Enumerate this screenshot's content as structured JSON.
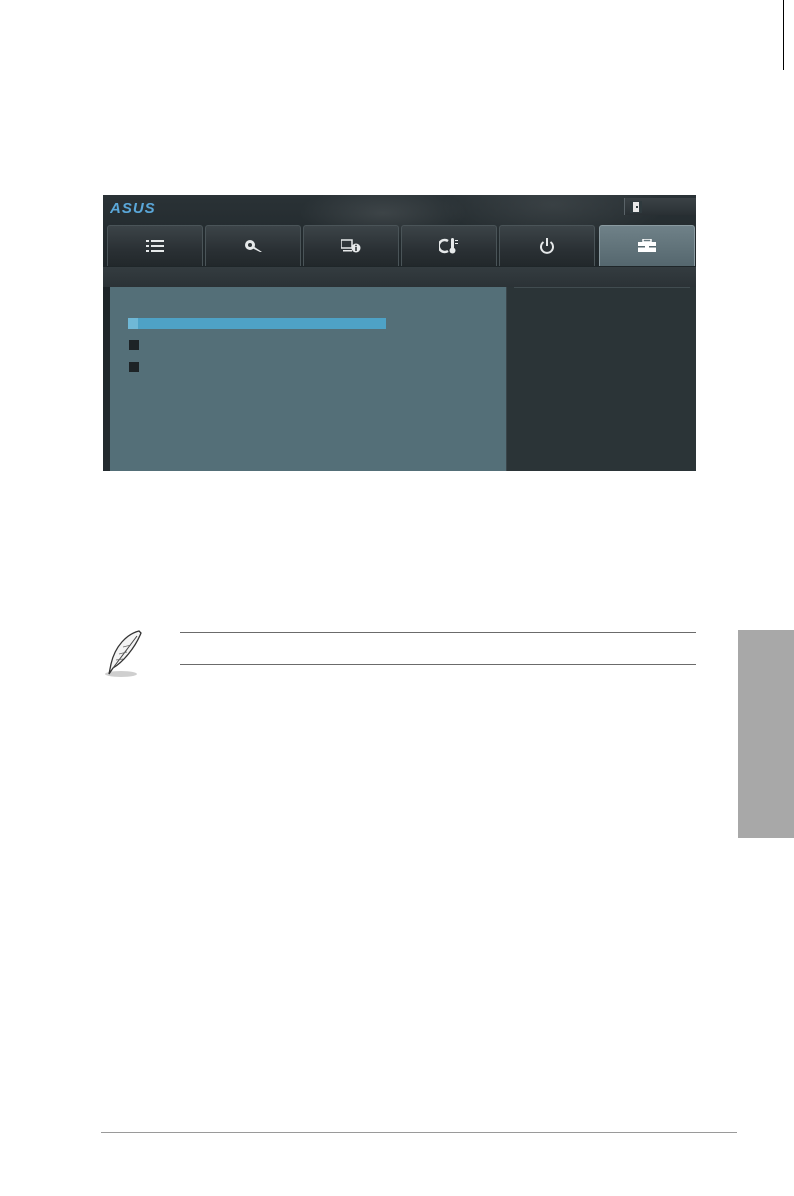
{
  "bios": {
    "logo_text": "ASUS",
    "exit_icon": "exit-door-icon",
    "tabs": [
      {
        "icon": "list-icon",
        "active": false
      },
      {
        "icon": "tweaker-icon",
        "active": false
      },
      {
        "icon": "advanced-info-icon",
        "active": false
      },
      {
        "icon": "monitor-thermometer-icon",
        "active": false
      },
      {
        "icon": "power-icon",
        "active": false
      },
      {
        "icon": "toolbox-icon",
        "active": true
      }
    ],
    "menu_items": [
      {
        "state": "selected"
      },
      {
        "state": "normal"
      },
      {
        "state": "normal"
      }
    ]
  },
  "note": {
    "icon": "feather-pen-icon"
  },
  "colors": {
    "highlight": "#4ea2c6",
    "panel": "#546f78",
    "side_tab": "#a8a8a8"
  }
}
